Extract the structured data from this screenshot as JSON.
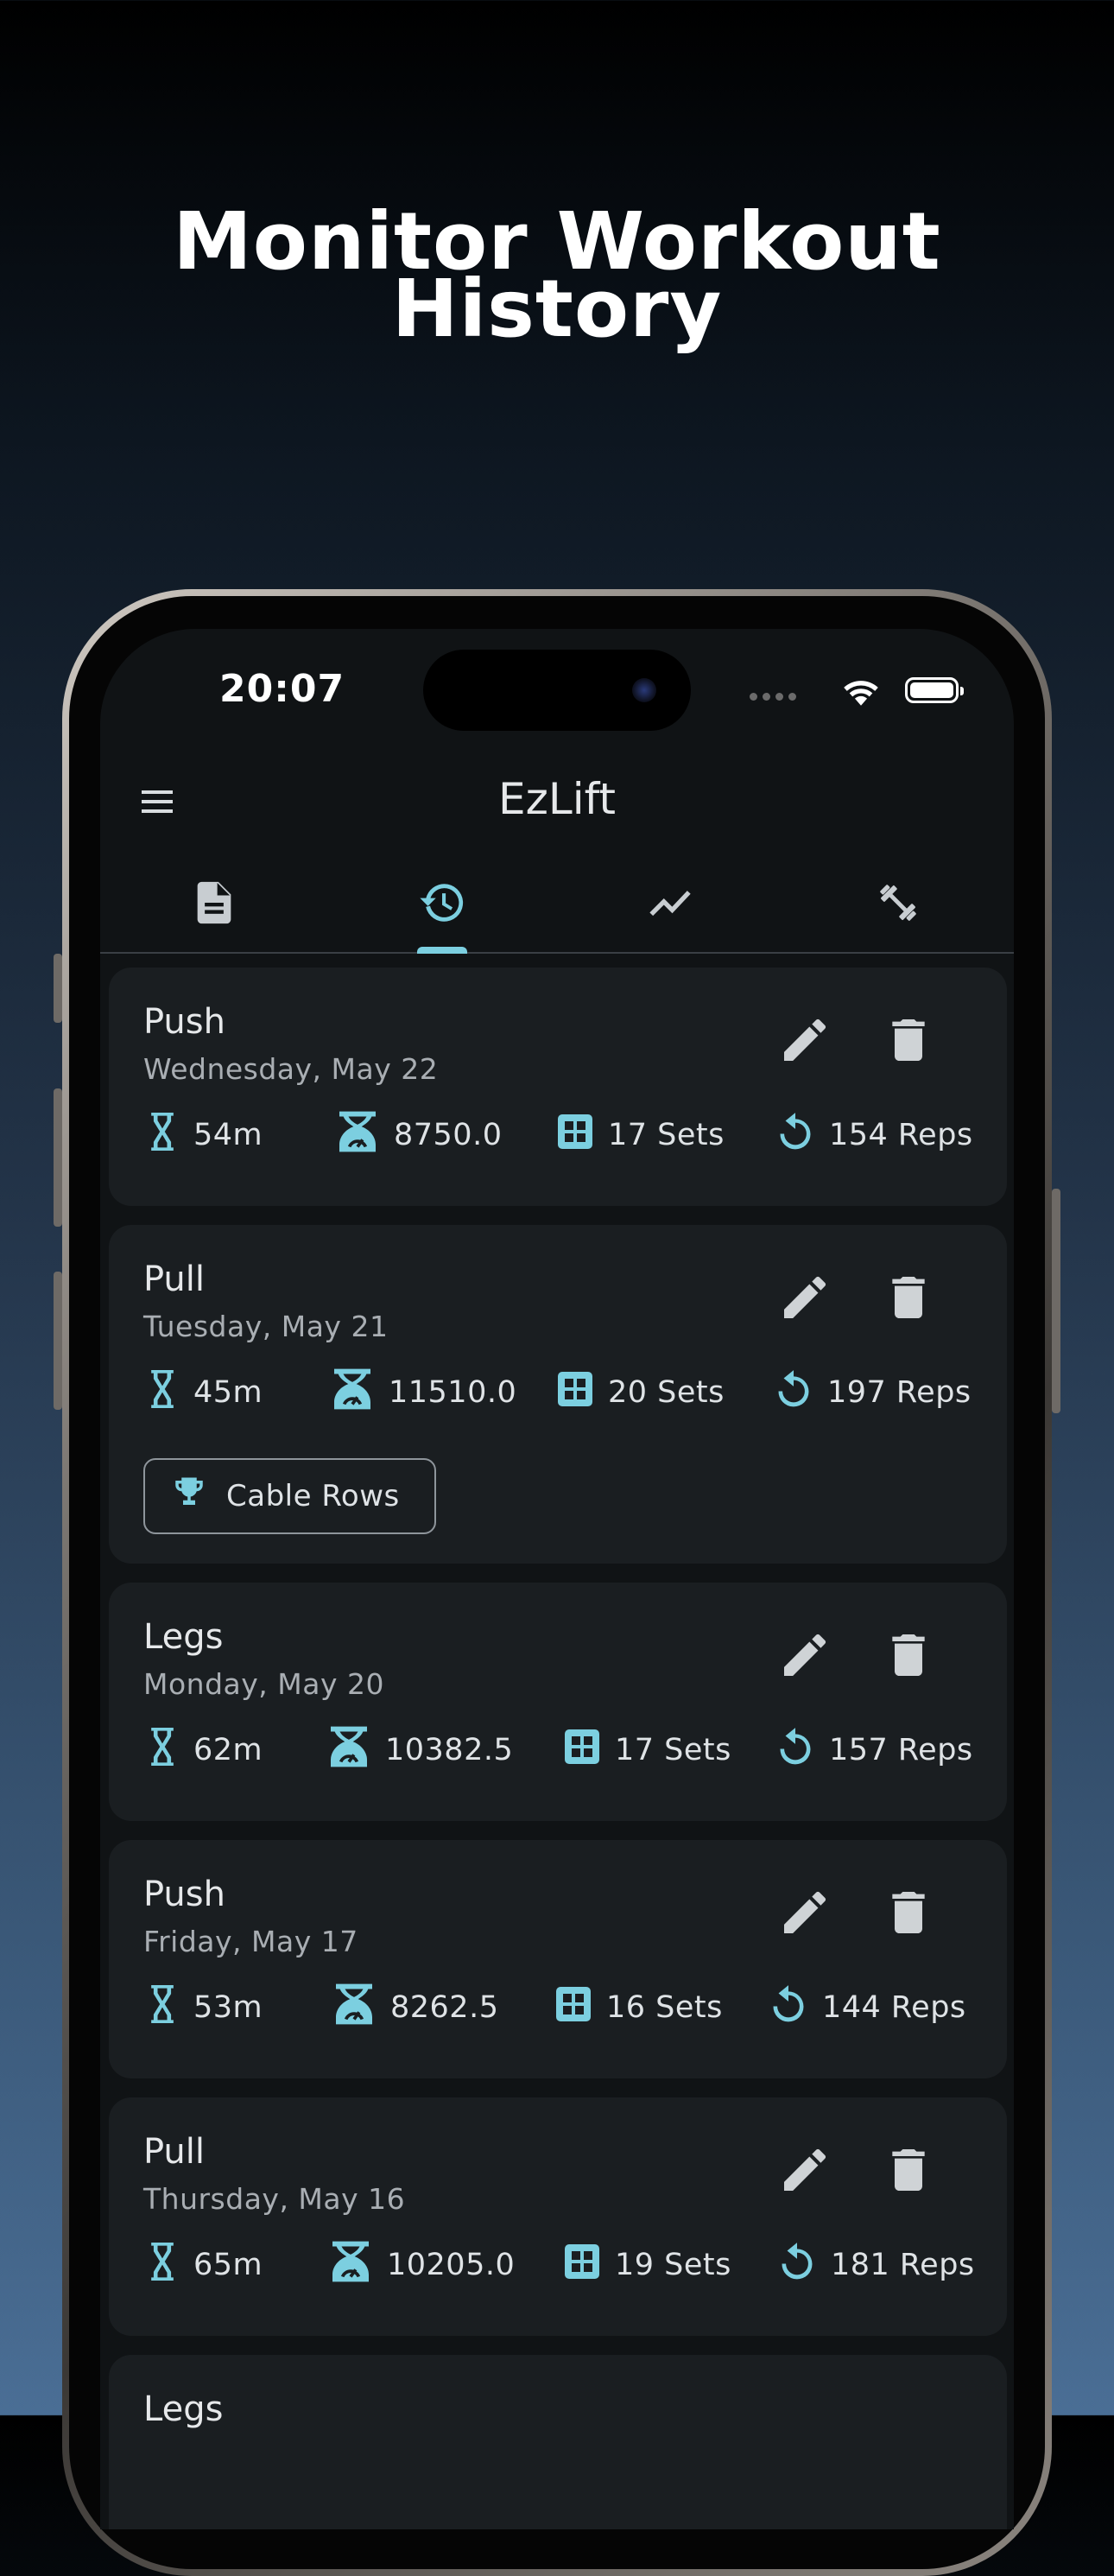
{
  "headline": {
    "line1": "Monitor Workout",
    "line2": "History"
  },
  "status_bar": {
    "time": "20:07"
  },
  "app": {
    "title": "EzLift"
  },
  "tabs": [
    {
      "icon": "document-icon",
      "active": false
    },
    {
      "icon": "history-icon",
      "active": true
    },
    {
      "icon": "trend-icon",
      "active": false
    },
    {
      "icon": "dumbbell-icon",
      "active": false
    }
  ],
  "colors": {
    "accent": "#7ccfe0",
    "card": "#1a1e21",
    "background": "#101315"
  },
  "workouts": [
    {
      "name": "Push",
      "date": "Wednesday, May 22",
      "duration": "54m",
      "volume": "8750.0",
      "sets": "17 Sets",
      "reps": "154 Reps"
    },
    {
      "name": "Pull",
      "date": "Tuesday, May 21",
      "duration": "45m",
      "volume": "11510.0",
      "sets": "20 Sets",
      "reps": "197 Reps",
      "record": "Cable Rows"
    },
    {
      "name": "Legs",
      "date": "Monday, May 20",
      "duration": "62m",
      "volume": "10382.5",
      "sets": "17 Sets",
      "reps": "157 Reps"
    },
    {
      "name": "Push",
      "date": "Friday, May 17",
      "duration": "53m",
      "volume": "8262.5",
      "sets": "16 Sets",
      "reps": "144 Reps"
    },
    {
      "name": "Pull",
      "date": "Thursday, May 16",
      "duration": "65m",
      "volume": "10205.0",
      "sets": "19 Sets",
      "reps": "181 Reps"
    },
    {
      "name": "Legs"
    }
  ]
}
